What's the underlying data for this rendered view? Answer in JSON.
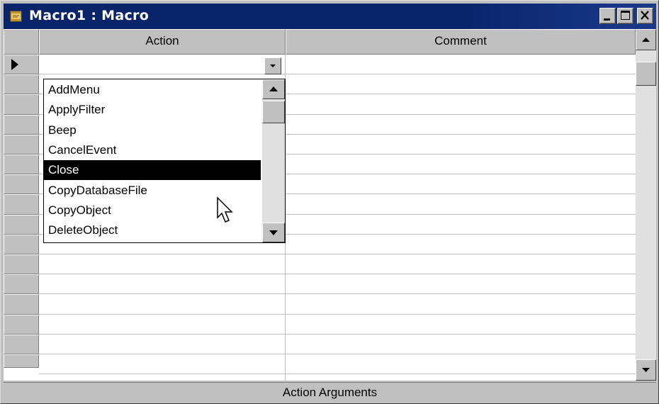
{
  "window": {
    "title": "Macro1 : Macro"
  },
  "titlebar_buttons": [
    {
      "name": "minimize-button",
      "icon": "minimize-icon"
    },
    {
      "name": "maximize-button",
      "icon": "maximize-icon"
    },
    {
      "name": "close-button",
      "icon": "close-icon"
    }
  ],
  "grid": {
    "columns": [
      "Action",
      "Comment"
    ],
    "current_row_indicator": "row-pointer-icon",
    "current_action_value": ""
  },
  "dropdown": {
    "items": [
      "AddMenu",
      "ApplyFilter",
      "Beep",
      "CancelEvent",
      "Close",
      "CopyDatabaseFile",
      "CopyObject",
      "DeleteObject"
    ],
    "selected": "Close"
  },
  "footer": {
    "label": "Action Arguments"
  },
  "colors": {
    "titlebar": "#0a246a",
    "face": "#c0c0c0",
    "selection": "#000000"
  }
}
